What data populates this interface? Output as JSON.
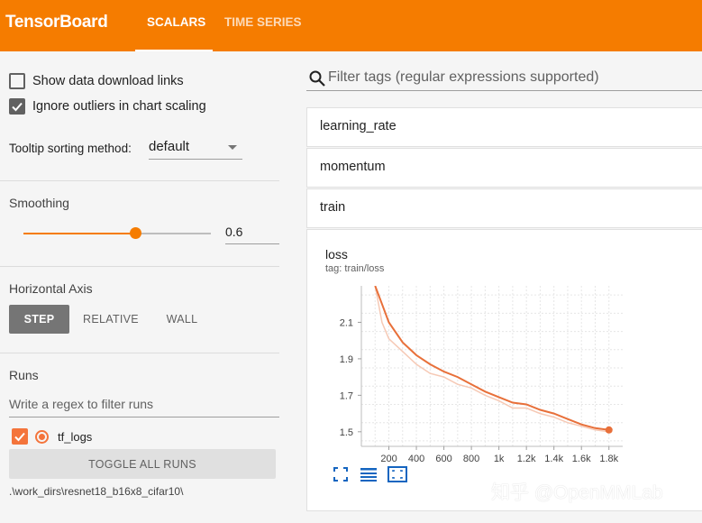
{
  "header": {
    "brand": "TensorBoard",
    "tabs": [
      {
        "label": "SCALARS",
        "active": true
      },
      {
        "label": "TIME SERIES",
        "active": false
      }
    ],
    "color": "#f57c00"
  },
  "sidebar": {
    "show_download_links": {
      "label": "Show data download links",
      "checked": false
    },
    "ignore_outliers": {
      "label": "Ignore outliers in chart scaling",
      "checked": true
    },
    "tooltip_sorting": {
      "label": "Tooltip sorting method:",
      "value": "default"
    },
    "smoothing": {
      "label": "Smoothing",
      "value": "0.6",
      "fraction": 0.6
    },
    "horizontal_axis": {
      "label": "Horizontal Axis",
      "options": [
        "STEP",
        "RELATIVE",
        "WALL"
      ],
      "selected": "STEP"
    },
    "runs": {
      "label": "Runs",
      "filter_placeholder": "Write a regex to filter runs",
      "items": [
        {
          "name": "tf_logs",
          "checked": true,
          "color": "#f4743b"
        }
      ],
      "toggle_label": "TOGGLE ALL RUNS",
      "path": ".\\work_dirs\\resnet18_b16x8_cifar10\\"
    }
  },
  "main": {
    "filter_placeholder": "Filter tags (regular expressions supported)",
    "groups": [
      "learning_rate",
      "momentum",
      "train"
    ],
    "card": {
      "title": "loss",
      "tag": "tag: train/loss",
      "icons": [
        "fit-to-screen-icon",
        "data-table-icon",
        "fit-domain-icon"
      ]
    }
  },
  "chart_data": {
    "type": "line",
    "title": "loss",
    "subtitle": "tag: train/loss",
    "x_ticks": [
      "200",
      "400",
      "600",
      "800",
      "1k",
      "1.2k",
      "1.4k",
      "1.6k",
      "1.8k"
    ],
    "y_ticks": [
      "1.5",
      "1.7",
      "1.9",
      "2.1"
    ],
    "xlim": [
      0,
      1900
    ],
    "ylim": [
      1.42,
      2.3
    ],
    "grid": true,
    "series": [
      {
        "role": "smoothed",
        "color": "#e8703a",
        "x": [
          100,
          150,
          200,
          300,
          400,
          500,
          600,
          700,
          800,
          900,
          1000,
          1100,
          1200,
          1300,
          1400,
          1500,
          1600,
          1700,
          1800
        ],
        "y": [
          2.3,
          2.2,
          2.1,
          1.99,
          1.92,
          1.87,
          1.83,
          1.8,
          1.76,
          1.72,
          1.69,
          1.66,
          1.65,
          1.62,
          1.6,
          1.57,
          1.54,
          1.52,
          1.51
        ]
      },
      {
        "role": "raw",
        "color": "#f6c9b5",
        "x": [
          100,
          150,
          200,
          300,
          400,
          500,
          600,
          700,
          800,
          900,
          1000,
          1100,
          1200,
          1300,
          1400,
          1500,
          1600,
          1700,
          1800
        ],
        "y": [
          2.3,
          2.1,
          2.01,
          1.94,
          1.87,
          1.82,
          1.8,
          1.76,
          1.74,
          1.7,
          1.67,
          1.63,
          1.63,
          1.6,
          1.58,
          1.55,
          1.53,
          1.51,
          1.5
        ]
      }
    ],
    "last_point": {
      "x": 1800,
      "y": 1.51
    }
  },
  "watermark": "知乎 @OpenMMLab"
}
